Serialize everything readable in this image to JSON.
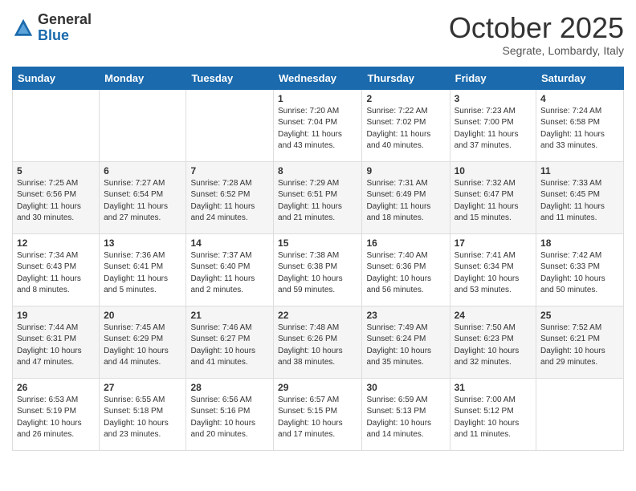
{
  "header": {
    "logo_general": "General",
    "logo_blue": "Blue",
    "month_title": "October 2025",
    "location": "Segrate, Lombardy, Italy"
  },
  "days_of_week": [
    "Sunday",
    "Monday",
    "Tuesday",
    "Wednesday",
    "Thursday",
    "Friday",
    "Saturday"
  ],
  "weeks": [
    [
      {
        "day": "",
        "info": ""
      },
      {
        "day": "",
        "info": ""
      },
      {
        "day": "",
        "info": ""
      },
      {
        "day": "1",
        "info": "Sunrise: 7:20 AM\nSunset: 7:04 PM\nDaylight: 11 hours\nand 43 minutes."
      },
      {
        "day": "2",
        "info": "Sunrise: 7:22 AM\nSunset: 7:02 PM\nDaylight: 11 hours\nand 40 minutes."
      },
      {
        "day": "3",
        "info": "Sunrise: 7:23 AM\nSunset: 7:00 PM\nDaylight: 11 hours\nand 37 minutes."
      },
      {
        "day": "4",
        "info": "Sunrise: 7:24 AM\nSunset: 6:58 PM\nDaylight: 11 hours\nand 33 minutes."
      }
    ],
    [
      {
        "day": "5",
        "info": "Sunrise: 7:25 AM\nSunset: 6:56 PM\nDaylight: 11 hours\nand 30 minutes."
      },
      {
        "day": "6",
        "info": "Sunrise: 7:27 AM\nSunset: 6:54 PM\nDaylight: 11 hours\nand 27 minutes."
      },
      {
        "day": "7",
        "info": "Sunrise: 7:28 AM\nSunset: 6:52 PM\nDaylight: 11 hours\nand 24 minutes."
      },
      {
        "day": "8",
        "info": "Sunrise: 7:29 AM\nSunset: 6:51 PM\nDaylight: 11 hours\nand 21 minutes."
      },
      {
        "day": "9",
        "info": "Sunrise: 7:31 AM\nSunset: 6:49 PM\nDaylight: 11 hours\nand 18 minutes."
      },
      {
        "day": "10",
        "info": "Sunrise: 7:32 AM\nSunset: 6:47 PM\nDaylight: 11 hours\nand 15 minutes."
      },
      {
        "day": "11",
        "info": "Sunrise: 7:33 AM\nSunset: 6:45 PM\nDaylight: 11 hours\nand 11 minutes."
      }
    ],
    [
      {
        "day": "12",
        "info": "Sunrise: 7:34 AM\nSunset: 6:43 PM\nDaylight: 11 hours\nand 8 minutes."
      },
      {
        "day": "13",
        "info": "Sunrise: 7:36 AM\nSunset: 6:41 PM\nDaylight: 11 hours\nand 5 minutes."
      },
      {
        "day": "14",
        "info": "Sunrise: 7:37 AM\nSunset: 6:40 PM\nDaylight: 11 hours\nand 2 minutes."
      },
      {
        "day": "15",
        "info": "Sunrise: 7:38 AM\nSunset: 6:38 PM\nDaylight: 10 hours\nand 59 minutes."
      },
      {
        "day": "16",
        "info": "Sunrise: 7:40 AM\nSunset: 6:36 PM\nDaylight: 10 hours\nand 56 minutes."
      },
      {
        "day": "17",
        "info": "Sunrise: 7:41 AM\nSunset: 6:34 PM\nDaylight: 10 hours\nand 53 minutes."
      },
      {
        "day": "18",
        "info": "Sunrise: 7:42 AM\nSunset: 6:33 PM\nDaylight: 10 hours\nand 50 minutes."
      }
    ],
    [
      {
        "day": "19",
        "info": "Sunrise: 7:44 AM\nSunset: 6:31 PM\nDaylight: 10 hours\nand 47 minutes."
      },
      {
        "day": "20",
        "info": "Sunrise: 7:45 AM\nSunset: 6:29 PM\nDaylight: 10 hours\nand 44 minutes."
      },
      {
        "day": "21",
        "info": "Sunrise: 7:46 AM\nSunset: 6:27 PM\nDaylight: 10 hours\nand 41 minutes."
      },
      {
        "day": "22",
        "info": "Sunrise: 7:48 AM\nSunset: 6:26 PM\nDaylight: 10 hours\nand 38 minutes."
      },
      {
        "day": "23",
        "info": "Sunrise: 7:49 AM\nSunset: 6:24 PM\nDaylight: 10 hours\nand 35 minutes."
      },
      {
        "day": "24",
        "info": "Sunrise: 7:50 AM\nSunset: 6:23 PM\nDaylight: 10 hours\nand 32 minutes."
      },
      {
        "day": "25",
        "info": "Sunrise: 7:52 AM\nSunset: 6:21 PM\nDaylight: 10 hours\nand 29 minutes."
      }
    ],
    [
      {
        "day": "26",
        "info": "Sunrise: 6:53 AM\nSunset: 5:19 PM\nDaylight: 10 hours\nand 26 minutes."
      },
      {
        "day": "27",
        "info": "Sunrise: 6:55 AM\nSunset: 5:18 PM\nDaylight: 10 hours\nand 23 minutes."
      },
      {
        "day": "28",
        "info": "Sunrise: 6:56 AM\nSunset: 5:16 PM\nDaylight: 10 hours\nand 20 minutes."
      },
      {
        "day": "29",
        "info": "Sunrise: 6:57 AM\nSunset: 5:15 PM\nDaylight: 10 hours\nand 17 minutes."
      },
      {
        "day": "30",
        "info": "Sunrise: 6:59 AM\nSunset: 5:13 PM\nDaylight: 10 hours\nand 14 minutes."
      },
      {
        "day": "31",
        "info": "Sunrise: 7:00 AM\nSunset: 5:12 PM\nDaylight: 10 hours\nand 11 minutes."
      },
      {
        "day": "",
        "info": ""
      }
    ]
  ]
}
